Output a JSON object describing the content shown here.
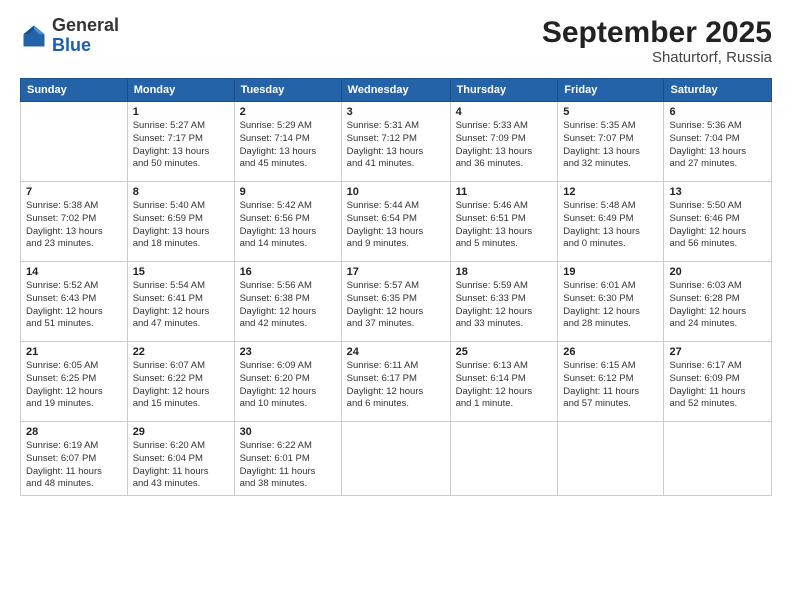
{
  "logo": {
    "general": "General",
    "blue": "Blue"
  },
  "header": {
    "month": "September 2025",
    "location": "Shaturtorf, Russia"
  },
  "weekdays": [
    "Sunday",
    "Monday",
    "Tuesday",
    "Wednesday",
    "Thursday",
    "Friday",
    "Saturday"
  ],
  "weeks": [
    [
      {
        "day": "",
        "info": ""
      },
      {
        "day": "1",
        "info": "Sunrise: 5:27 AM\nSunset: 7:17 PM\nDaylight: 13 hours\nand 50 minutes."
      },
      {
        "day": "2",
        "info": "Sunrise: 5:29 AM\nSunset: 7:14 PM\nDaylight: 13 hours\nand 45 minutes."
      },
      {
        "day": "3",
        "info": "Sunrise: 5:31 AM\nSunset: 7:12 PM\nDaylight: 13 hours\nand 41 minutes."
      },
      {
        "day": "4",
        "info": "Sunrise: 5:33 AM\nSunset: 7:09 PM\nDaylight: 13 hours\nand 36 minutes."
      },
      {
        "day": "5",
        "info": "Sunrise: 5:35 AM\nSunset: 7:07 PM\nDaylight: 13 hours\nand 32 minutes."
      },
      {
        "day": "6",
        "info": "Sunrise: 5:36 AM\nSunset: 7:04 PM\nDaylight: 13 hours\nand 27 minutes."
      }
    ],
    [
      {
        "day": "7",
        "info": "Sunrise: 5:38 AM\nSunset: 7:02 PM\nDaylight: 13 hours\nand 23 minutes."
      },
      {
        "day": "8",
        "info": "Sunrise: 5:40 AM\nSunset: 6:59 PM\nDaylight: 13 hours\nand 18 minutes."
      },
      {
        "day": "9",
        "info": "Sunrise: 5:42 AM\nSunset: 6:56 PM\nDaylight: 13 hours\nand 14 minutes."
      },
      {
        "day": "10",
        "info": "Sunrise: 5:44 AM\nSunset: 6:54 PM\nDaylight: 13 hours\nand 9 minutes."
      },
      {
        "day": "11",
        "info": "Sunrise: 5:46 AM\nSunset: 6:51 PM\nDaylight: 13 hours\nand 5 minutes."
      },
      {
        "day": "12",
        "info": "Sunrise: 5:48 AM\nSunset: 6:49 PM\nDaylight: 13 hours\nand 0 minutes."
      },
      {
        "day": "13",
        "info": "Sunrise: 5:50 AM\nSunset: 6:46 PM\nDaylight: 12 hours\nand 56 minutes."
      }
    ],
    [
      {
        "day": "14",
        "info": "Sunrise: 5:52 AM\nSunset: 6:43 PM\nDaylight: 12 hours\nand 51 minutes."
      },
      {
        "day": "15",
        "info": "Sunrise: 5:54 AM\nSunset: 6:41 PM\nDaylight: 12 hours\nand 47 minutes."
      },
      {
        "day": "16",
        "info": "Sunrise: 5:56 AM\nSunset: 6:38 PM\nDaylight: 12 hours\nand 42 minutes."
      },
      {
        "day": "17",
        "info": "Sunrise: 5:57 AM\nSunset: 6:35 PM\nDaylight: 12 hours\nand 37 minutes."
      },
      {
        "day": "18",
        "info": "Sunrise: 5:59 AM\nSunset: 6:33 PM\nDaylight: 12 hours\nand 33 minutes."
      },
      {
        "day": "19",
        "info": "Sunrise: 6:01 AM\nSunset: 6:30 PM\nDaylight: 12 hours\nand 28 minutes."
      },
      {
        "day": "20",
        "info": "Sunrise: 6:03 AM\nSunset: 6:28 PM\nDaylight: 12 hours\nand 24 minutes."
      }
    ],
    [
      {
        "day": "21",
        "info": "Sunrise: 6:05 AM\nSunset: 6:25 PM\nDaylight: 12 hours\nand 19 minutes."
      },
      {
        "day": "22",
        "info": "Sunrise: 6:07 AM\nSunset: 6:22 PM\nDaylight: 12 hours\nand 15 minutes."
      },
      {
        "day": "23",
        "info": "Sunrise: 6:09 AM\nSunset: 6:20 PM\nDaylight: 12 hours\nand 10 minutes."
      },
      {
        "day": "24",
        "info": "Sunrise: 6:11 AM\nSunset: 6:17 PM\nDaylight: 12 hours\nand 6 minutes."
      },
      {
        "day": "25",
        "info": "Sunrise: 6:13 AM\nSunset: 6:14 PM\nDaylight: 12 hours\nand 1 minute."
      },
      {
        "day": "26",
        "info": "Sunrise: 6:15 AM\nSunset: 6:12 PM\nDaylight: 11 hours\nand 57 minutes."
      },
      {
        "day": "27",
        "info": "Sunrise: 6:17 AM\nSunset: 6:09 PM\nDaylight: 11 hours\nand 52 minutes."
      }
    ],
    [
      {
        "day": "28",
        "info": "Sunrise: 6:19 AM\nSunset: 6:07 PM\nDaylight: 11 hours\nand 48 minutes."
      },
      {
        "day": "29",
        "info": "Sunrise: 6:20 AM\nSunset: 6:04 PM\nDaylight: 11 hours\nand 43 minutes."
      },
      {
        "day": "30",
        "info": "Sunrise: 6:22 AM\nSunset: 6:01 PM\nDaylight: 11 hours\nand 38 minutes."
      },
      {
        "day": "",
        "info": ""
      },
      {
        "day": "",
        "info": ""
      },
      {
        "day": "",
        "info": ""
      },
      {
        "day": "",
        "info": ""
      }
    ]
  ]
}
